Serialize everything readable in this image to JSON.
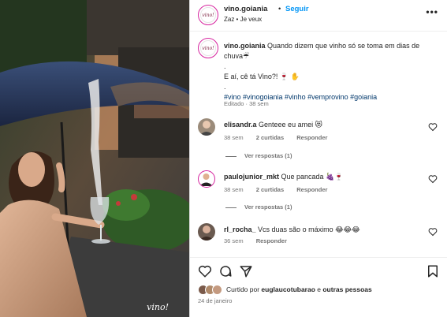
{
  "post": {
    "username": "vino.goiania",
    "separator": "•",
    "follow_label": "Seguir",
    "subtitle": "Zaz • Je veux",
    "more_label": "•••",
    "watermark": "vino!",
    "avatar_text": "vino!"
  },
  "caption": {
    "username": "vino.goiania",
    "line1": " Quando dizem que vinho só se toma em dias de chuva☔",
    "dot1": ".",
    "line2": "E aí, cê tá Vino?! 🍷 ✋",
    "dot2": ".",
    "hashtags": "#vino #vinogoiania #vinho #vemprovino #goiania",
    "edited": "Editado · 38 sem"
  },
  "comments": [
    {
      "username": "elisandr.a",
      "text": " Genteee eu amei 😻",
      "age": "38 sem",
      "likes": "2 curtidas",
      "reply": "Responder",
      "view_replies": "Ver respostas (1)"
    },
    {
      "username": "paulojunior_mkt",
      "text": " Que pancada 🍇🍷",
      "age": "38 sem",
      "likes": "2 curtidas",
      "reply": "Responder",
      "view_replies": "Ver respostas (1)"
    },
    {
      "username": "rl_rocha_",
      "text": " Vcs duas são o máximo 😂😂😂",
      "age": "36 sem",
      "reply": "Responder"
    }
  ],
  "footer": {
    "liked_prefix": "Curtido por ",
    "liked_user": "euglaucotubarao",
    "liked_mid": " e ",
    "liked_others": "outras pessoas",
    "date": "24 de janeiro"
  },
  "icons": {
    "heart": "heart-icon",
    "comment": "comment-icon",
    "share": "share-icon",
    "save": "bookmark-icon",
    "more": "more-options-icon"
  },
  "colors": {
    "follow": "#0095f6",
    "secondary_text": "#737373",
    "hashtag": "#00376b",
    "avatar_ring": "#d6249f"
  }
}
